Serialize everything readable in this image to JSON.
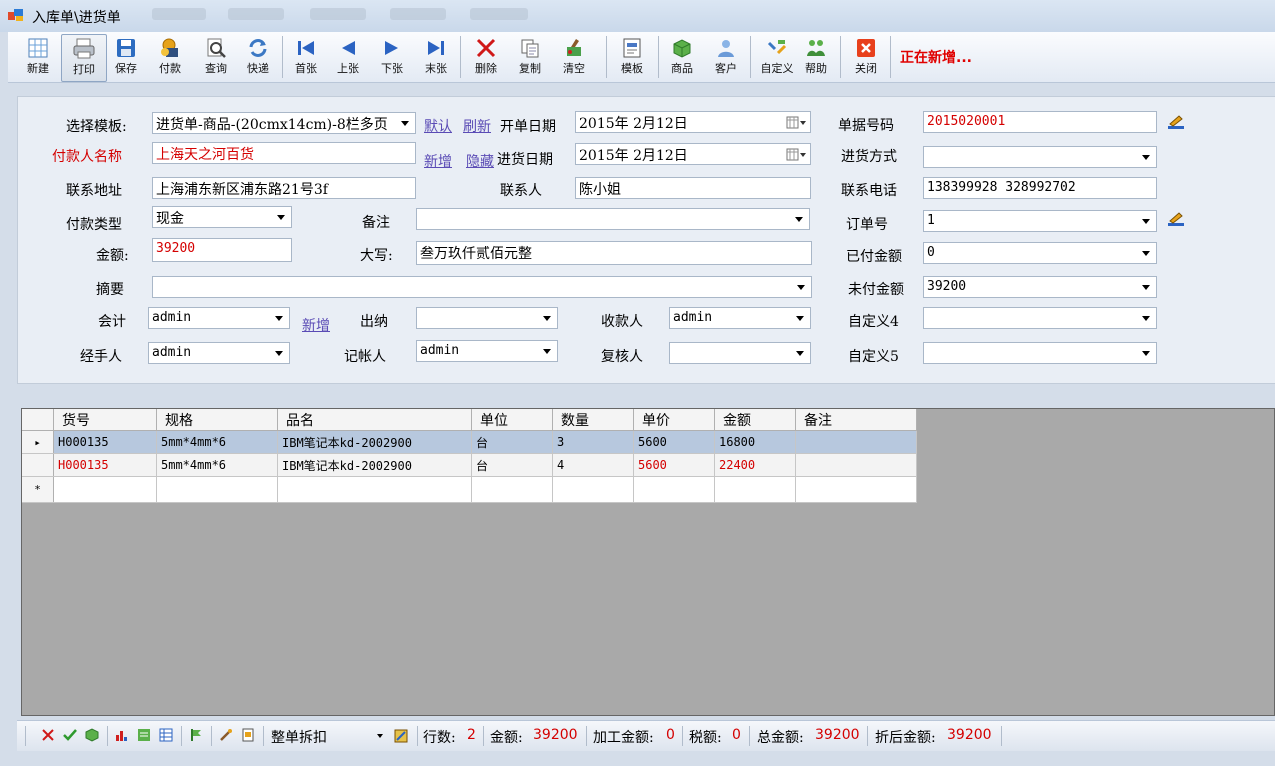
{
  "window": {
    "title": "入库单\\进货单"
  },
  "toolbar": {
    "buttons": [
      {
        "label": "新建",
        "icon": "grid-new-icon"
      },
      {
        "label": "打印",
        "icon": "printer-icon"
      },
      {
        "label": "保存",
        "icon": "floppy-disk-icon"
      },
      {
        "label": "付款",
        "icon": "payment-icon"
      },
      {
        "label": "查询",
        "icon": "magnifier-icon"
      },
      {
        "label": "快递",
        "icon": "refresh-icon"
      },
      {
        "label": "首张",
        "icon": "first-icon"
      },
      {
        "label": "上张",
        "icon": "prev-icon"
      },
      {
        "label": "下张",
        "icon": "next-icon"
      },
      {
        "label": "末张",
        "icon": "last-icon"
      },
      {
        "label": "删除",
        "icon": "delete-x-icon"
      },
      {
        "label": "复制",
        "icon": "copy-icon"
      },
      {
        "label": "清空",
        "icon": "clear-icon"
      },
      {
        "label": "模板",
        "icon": "template-icon"
      },
      {
        "label": "商品",
        "icon": "product-icon"
      },
      {
        "label": "客户",
        "icon": "customer-icon"
      },
      {
        "label": "自定义",
        "icon": "customize-icon"
      },
      {
        "label": "帮助",
        "icon": "help-icon"
      },
      {
        "label": "关闭",
        "icon": "close-icon"
      }
    ],
    "status": "正在新增..."
  },
  "form": {
    "template_label": "选择模板:",
    "template_value": "进货单-商品-(20cmx14cm)-8栏多页",
    "default_link": "默认",
    "refresh_link": "刷新",
    "open_date_label": "开单日期",
    "open_date_value": "2015年 2月12日",
    "doc_no_label": "单据号码",
    "doc_no_value": "2015020001",
    "payer_label": "付款人名称",
    "payer_value": "上海天之河百货",
    "add_link": "新增",
    "hide_link": "隐藏",
    "stock_date_label": "进货日期",
    "stock_date_value": "2015年 2月12日",
    "stock_method_label": "进货方式",
    "stock_method_value": "",
    "address_label": "联系地址",
    "address_value": "上海浦东新区浦东路21号3f",
    "contact_label": "联系人",
    "contact_value": "陈小姐",
    "phone_label": "联系电话",
    "phone_value": "138399928 328992702",
    "pay_type_label": "付款类型",
    "pay_type_value": "现金",
    "note_label": "备注",
    "note_value": "",
    "order_no_label": "订单号",
    "order_no_value": "1",
    "amount_label": "金额:",
    "amount_value": "39200",
    "capital_label": "大写:",
    "capital_value": "叁万玖仟贰佰元整",
    "paid_label": "已付金额",
    "paid_value": "0",
    "summary_label": "摘要",
    "summary_value": "",
    "unpaid_label": "未付金额",
    "unpaid_value": "39200",
    "accountant_label": "会计",
    "accountant_value": "admin",
    "add_link2": "新增",
    "cashier_label": "出纳",
    "cashier_value": "",
    "payee_label": "收款人",
    "payee_value": "admin",
    "custom4_label": "自定义4",
    "custom4_value": "",
    "handler_label": "经手人",
    "handler_value": "admin",
    "bookkeeper_label": "记帐人",
    "bookkeeper_value": "admin",
    "reviewer_label": "复核人",
    "reviewer_value": "",
    "custom5_label": "自定义5",
    "custom5_value": ""
  },
  "grid": {
    "columns": [
      "货号",
      "规格",
      "品名",
      "单位",
      "数量",
      "单价",
      "金额",
      "备注"
    ],
    "rows": [
      {
        "marker": "▸",
        "code": "H000135",
        "spec": "5mm*4mm*6",
        "name": "IBM笔记本kd-2002900",
        "unit": "台",
        "qty": "3",
        "price": "5600",
        "amount": "16800",
        "note": ""
      },
      {
        "marker": "",
        "code": "H000135",
        "spec": "5mm*4mm*6",
        "name": "IBM笔记本kd-2002900",
        "unit": "台",
        "qty": "4",
        "price": "5600",
        "amount": "22400",
        "note": ""
      }
    ],
    "new_row_marker": "*"
  },
  "footer": {
    "discount_label": "整单拆扣",
    "rows_label": "行数:",
    "rows_value": "2",
    "amount_label": "金额:",
    "amount_value": "39200",
    "processing_label": "加工金额:",
    "processing_value": "0",
    "tax_label": "税额:",
    "tax_value": "0",
    "total_label": "总金额:",
    "total_value": "39200",
    "discounted_label": "折后金额:",
    "discounted_value": "39200"
  }
}
